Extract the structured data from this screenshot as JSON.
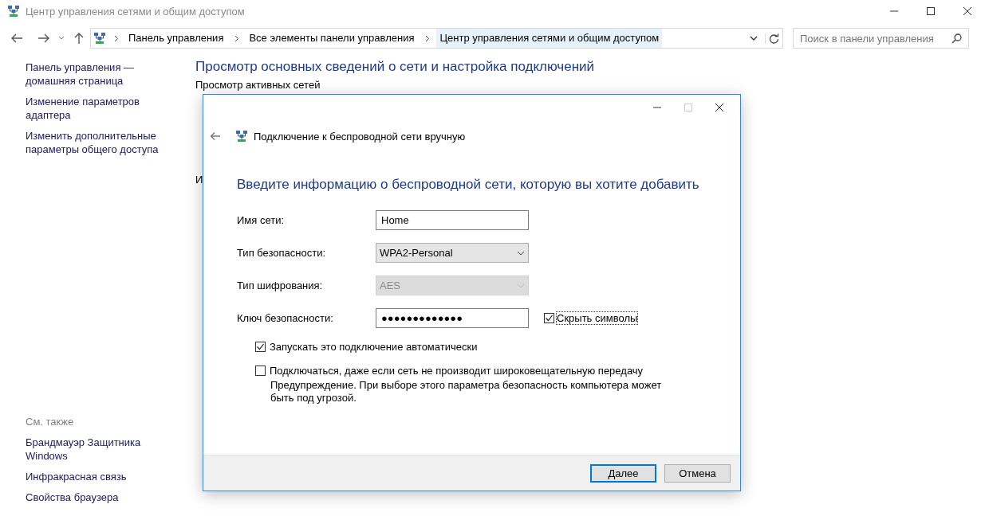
{
  "window": {
    "title": "Центр управления сетями и общим доступом"
  },
  "address_bar": {
    "path": [
      {
        "label": "Панель управления",
        "selected": false
      },
      {
        "label": "Все элементы панели управления",
        "selected": false
      },
      {
        "label": "Центр управления сетями и общим доступом",
        "selected": true
      }
    ],
    "search": {
      "placeholder": "Поиск в панели управления"
    }
  },
  "sidebar": {
    "links": [
      "Панель управления — домашняя страница",
      "Изменение параметров адаптера",
      "Изменить дополнительные параметры общего доступа"
    ],
    "see_also": {
      "heading": "См. также",
      "links": [
        "Брандмауэр Защитника Windows",
        "Инфракрасная связь",
        "Свойства браузера"
      ]
    }
  },
  "main": {
    "heading": "Просмотр основных сведений о сети и настройка подключений",
    "section_label": "Просмотр активных сетей",
    "partial_text": "И"
  },
  "dialog": {
    "title": "Подключение к беспроводной сети вручную",
    "heading": "Введите информацию о беспроводной сети, которую вы хотите добавить",
    "fields": [
      {
        "kind": "text",
        "label": "Имя сети:",
        "value": "Home"
      },
      {
        "kind": "dropdown",
        "label": "Тип безопасности:",
        "value": "WPA2-Personal",
        "disabled": false
      },
      {
        "kind": "dropdown",
        "label": "Тип шифрования:",
        "value": "AES",
        "disabled": true
      },
      {
        "kind": "password",
        "label": "Ключ безопасности:",
        "value": "●●●●●●●●●●●●●",
        "toggle": {
          "label": "Скрыть символы",
          "checked": true
        }
      }
    ],
    "options": [
      {
        "label": "Запускать это подключение автоматически",
        "checked": true
      },
      {
        "label": "Подключаться, даже если сеть не производит широковещательную передачу",
        "checked": false
      }
    ],
    "warning": "Предупреждение. При выборе этого параметра безопасность компьютера может быть под угрозой.",
    "buttons": [
      {
        "label": "Далее",
        "default": true
      },
      {
        "label": "Отмена",
        "default": false
      }
    ]
  }
}
